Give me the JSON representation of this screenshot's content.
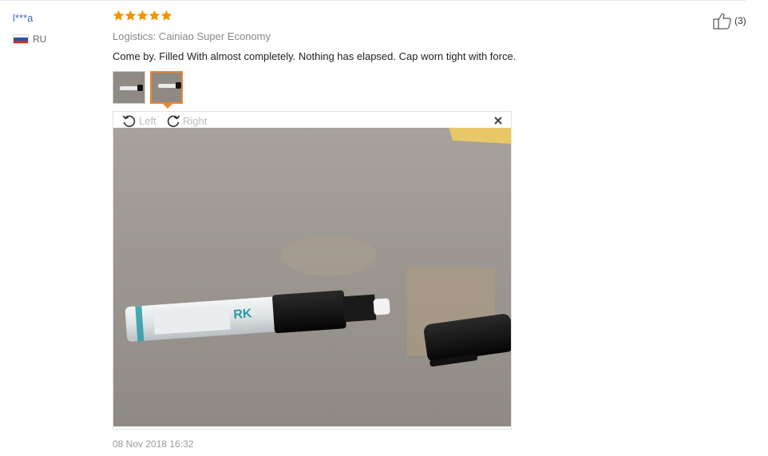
{
  "review": {
    "user_name": "l***a",
    "country_code": "RU",
    "rating": 5,
    "logistics": "Logistics: Cainiao Super Economy",
    "text": "Come by. Filled With almost completely. Nothing has elapsed. Cap worn tight with force.",
    "date": "08 Nov 2018 16:32",
    "helpful_count": "(3)"
  },
  "viewer": {
    "rotate_left_label": "Left",
    "rotate_right_label": "Right",
    "close_icon": "close-icon"
  },
  "photo_labels": {
    "pen_brand_text": "RK"
  },
  "colors": {
    "star": "#f29500",
    "link": "#3a6fb5",
    "active_border": "#f0852d",
    "muted": "#888888"
  }
}
